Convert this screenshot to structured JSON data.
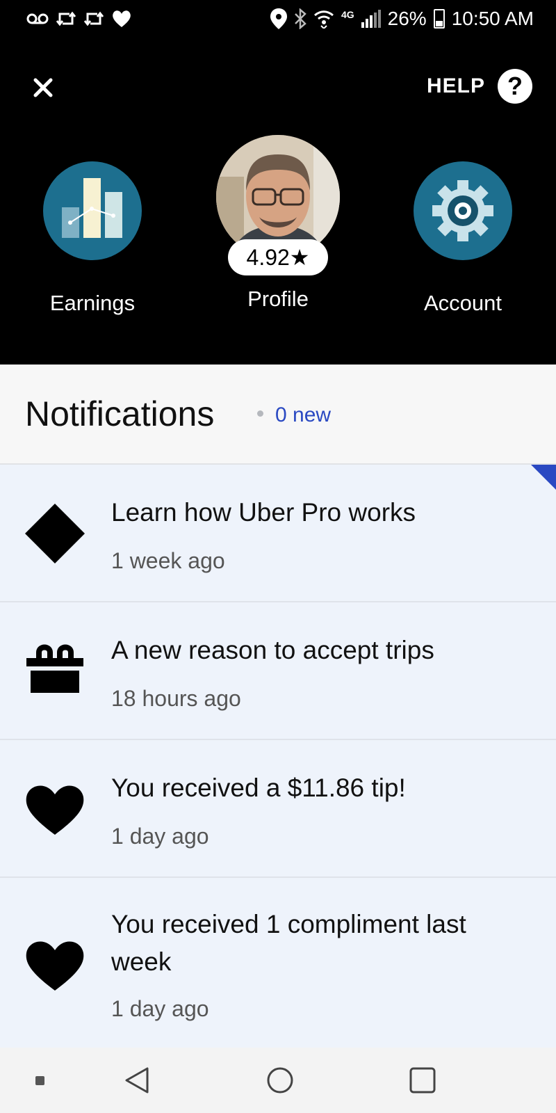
{
  "status_bar": {
    "left_icons": [
      "voicemail-icon",
      "retweet-icon",
      "retweet-icon",
      "heart-icon"
    ],
    "network": "4G",
    "battery": "26%",
    "time": "10:50 AM"
  },
  "header": {
    "help_label": "HELP",
    "help_icon": "?",
    "earnings_label": "Earnings",
    "profile_label": "Profile",
    "account_label": "Account",
    "rating": "4.92★",
    "accent_color": "#1d6f8f"
  },
  "notifications": {
    "title": "Notifications",
    "new_count": "0 new",
    "items": [
      {
        "icon": "diamond-icon",
        "title": "Learn how Uber Pro works",
        "time": "1 week ago",
        "unread_marker": true
      },
      {
        "icon": "gift-icon",
        "title": "A new reason to accept trips",
        "time": "18 hours ago",
        "unread_marker": false
      },
      {
        "icon": "heart-icon",
        "title": "You received a $11.86 tip!",
        "time": "1 day ago",
        "unread_marker": false
      },
      {
        "icon": "heart-icon",
        "title": "You received 1 compliment last week",
        "time": "1 day ago",
        "unread_marker": false
      }
    ]
  },
  "colors": {
    "link_blue": "#2a49c2",
    "list_background": "#eef3fb"
  }
}
